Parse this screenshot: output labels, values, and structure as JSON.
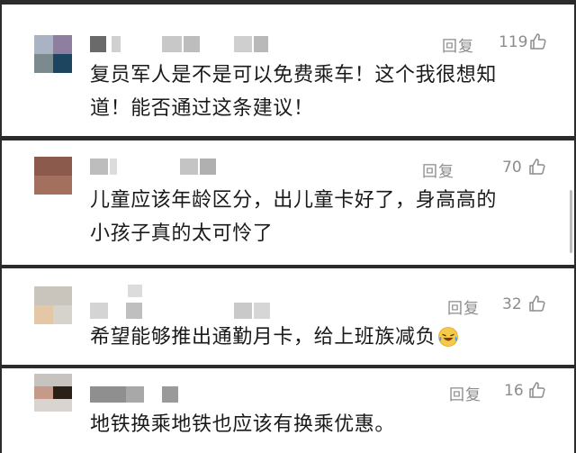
{
  "comments": [
    {
      "reply_label": "回复",
      "likes": "119",
      "lines": [
        "复员军人是不是可以免费乘车！这个我很想知",
        "道！能否通过这条建议！"
      ]
    },
    {
      "reply_label": "回复",
      "likes": "70",
      "lines": [
        "儿童应该年龄区分，出儿童卡好了，身高高的",
        "小孩子真的太可怜了"
      ]
    },
    {
      "reply_label": "回复",
      "likes": "32",
      "lines": [
        "希望能够推出通勤月卡，给上班族减负"
      ],
      "emoji": "laughing-crying-emoji"
    },
    {
      "reply_label": "回复",
      "likes": "16",
      "lines": [
        "地铁换乘地铁也应该有换乘优惠。"
      ]
    }
  ],
  "icons": {
    "like": "thumbs-up-icon"
  },
  "colors": {
    "meta_text": "#8c8c8c",
    "body_text": "#1a1a1a",
    "separator": "#2b2b2b"
  }
}
